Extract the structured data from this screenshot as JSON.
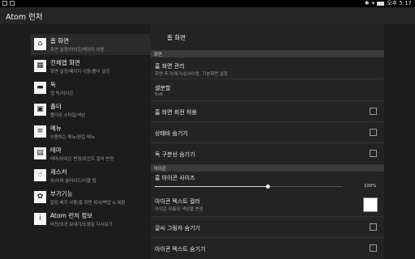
{
  "app": {
    "title": "Atom 런처"
  },
  "statusbar": {
    "time": "오후 5:17"
  },
  "sidebar": {
    "items": [
      {
        "label": "홈 화면",
        "sub": "화면 설정/아이콘/페이지 이동",
        "icon": "home-icon",
        "glyph": "⌂"
      },
      {
        "label": "전체앱 화면",
        "sub": "화면 설정/페이지 이동/폴더 설정",
        "icon": "app-grid-icon",
        "glyph": "▦"
      },
      {
        "label": "독",
        "sub": "앱 독/아이콘",
        "icon": "dock-icon",
        "glyph": "▬"
      },
      {
        "label": "폴더",
        "sub": "폴더의 스타일/색상",
        "icon": "folder-icon",
        "glyph": "▣"
      },
      {
        "label": "메뉴",
        "sub": "이용하는 메뉴/편집 메뉴",
        "icon": "menu-icon",
        "glyph": "≡"
      },
      {
        "label": "테마",
        "sub": "테마/아이콘 변경/포인트 컬러 변경",
        "icon": "theme-icon",
        "glyph": "▤"
      },
      {
        "label": "제스처",
        "sub": "위/아래 슬라이드/더블 탭",
        "icon": "gesture-icon",
        "glyph": "☝"
      },
      {
        "label": "부가기능",
        "sub": "알림 배지 사용/홈 화면 복사/백업 & 복원",
        "icon": "addon-icon",
        "glyph": "✿"
      },
      {
        "label": "Atom 런처 정보",
        "sub": "버전/의견 보내기/도움말 다시보기",
        "icon": "info-icon",
        "glyph": "i"
      }
    ]
  },
  "panel": {
    "title": "홈 화면",
    "section_screen": "화면",
    "section_icon": "아이콘",
    "rows": {
      "manage": {
        "title": "홈 화면 관리",
        "sub": "화면 추가/제거/순서이동, 기본화면 설정"
      },
      "grid": {
        "title": "셀분할",
        "sub": "6x6"
      },
      "rotate": {
        "title": "홈 화면 회전 허용",
        "checked": false
      },
      "hide_status": {
        "title": "상태바 숨기기",
        "checked": false
      },
      "hide_dock_divider": {
        "title": "독 구분선 숨기기",
        "checked": false
      },
      "icon_size": {
        "title": "홈 아이콘 사이즈",
        "value_label": "100%",
        "level": 0.6
      },
      "text_color": {
        "title": "아이콘 텍스트 컬러",
        "sub": "아이콘 이름의 색상을 변경",
        "color": "#ffffff"
      },
      "text_shadow": {
        "title": "글씨 그림자 숨기기",
        "checked": false
      },
      "hide_text": {
        "title": "아이콘 텍스트 숨기기",
        "checked": false
      }
    }
  }
}
